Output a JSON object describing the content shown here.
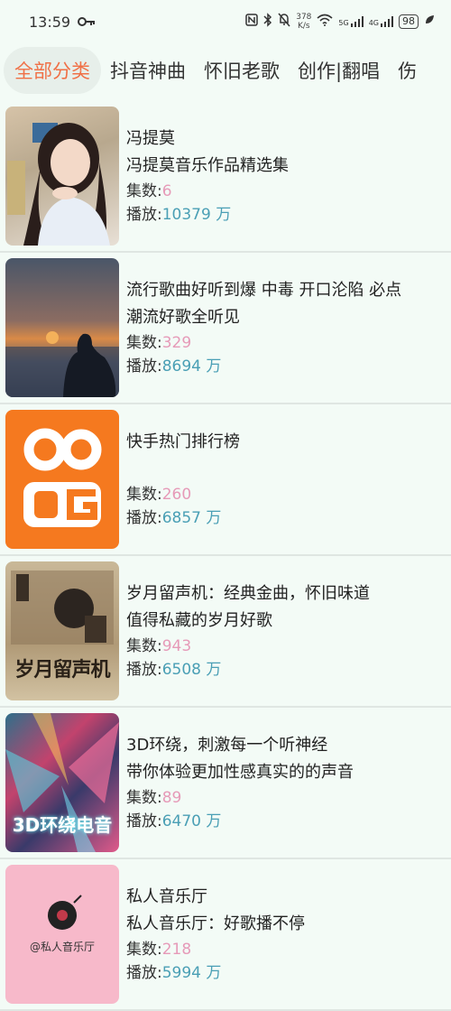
{
  "status": {
    "time": "13:59",
    "speed_top": "378",
    "speed_bottom": "K/s",
    "net1": "5G",
    "net2": "4G",
    "battery": "98"
  },
  "tabs": [
    "全部分类",
    "抖音神曲",
    "怀旧老歌",
    "创作|翻唱",
    "伤"
  ],
  "labels": {
    "episodes": "集数:",
    "plays": "播放:"
  },
  "items": [
    {
      "title": "冯提莫",
      "subtitle": "冯提莫音乐作品精选集",
      "episodes": "6",
      "plays": "10379 万"
    },
    {
      "title": "流行歌曲好听到爆 中毒 开口沦陷 必点",
      "subtitle": "潮流好歌全听见",
      "episodes": "329",
      "plays": "8694 万"
    },
    {
      "title": "快手热门排行榜",
      "subtitle": "",
      "episodes": "260",
      "plays": "6857 万"
    },
    {
      "title": "岁月留声机：经典金曲，怀旧味道",
      "subtitle": "值得私藏的岁月好歌",
      "episodes": "943",
      "plays": "6508 万"
    },
    {
      "title": "3D环绕，刺激每一个听神经",
      "subtitle": "带你体验更加性感真实的的声音",
      "episodes": "89",
      "plays": "6470 万"
    },
    {
      "title": "私人音乐厅",
      "subtitle": "私人音乐厅：好歌播不停",
      "episodes": "218",
      "plays": "5994 万"
    }
  ],
  "thumbs": {
    "t4_text": "岁月留声机",
    "t5_text": "3D环绕电音",
    "t6_text": "@私人音乐厅"
  }
}
